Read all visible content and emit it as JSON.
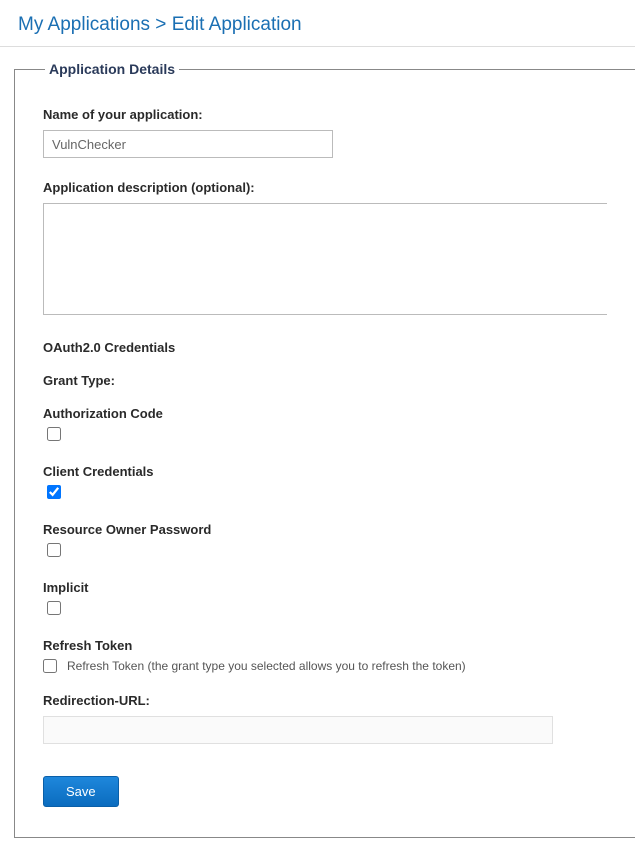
{
  "breadcrumb": {
    "my_apps": "My Applications",
    "separator": ">",
    "edit_app": "Edit Application"
  },
  "fieldset_legend": "Application Details",
  "form": {
    "name_label": "Name of your application:",
    "name_value": "VulnChecker",
    "desc_label": "Application description (optional):",
    "desc_value": "",
    "oauth_heading": "OAuth2.0 Credentials",
    "grant_type_label": "Grant Type:",
    "grant_types": {
      "auth_code": {
        "label": "Authorization Code",
        "checked": false
      },
      "client_cred": {
        "label": "Client Credentials",
        "checked": true
      },
      "resource_owner": {
        "label": "Resource Owner Password",
        "checked": false
      },
      "implicit": {
        "label": "Implicit",
        "checked": false
      }
    },
    "refresh_token": {
      "heading": "Refresh Token",
      "label": "Refresh Token (the grant type you selected allows you to refresh the token)",
      "checked": false
    },
    "redirect_label": "Redirection-URL:",
    "redirect_value": "",
    "save_label": "Save"
  }
}
